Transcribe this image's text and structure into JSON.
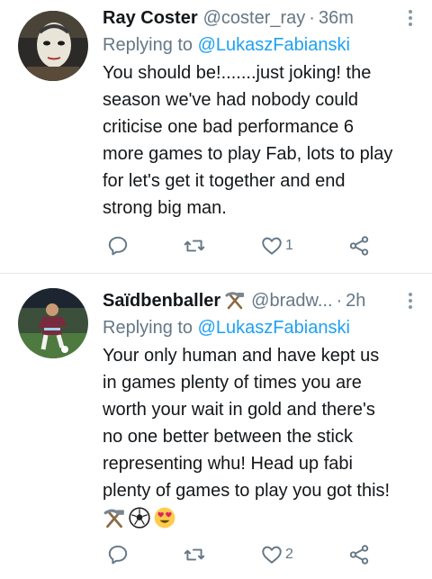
{
  "tweets": [
    {
      "name": "Ray Coster",
      "handle": "@coster_ray",
      "separator": "·",
      "time": "36m",
      "replying_prefix": "Replying to",
      "replying_to": "@LukaszFabianski",
      "text": "You should be!.......just joking! the\nseason we've had nobody could\ncriticise one bad performance 6\nmore games to play Fab, lots to play\nfor let's get it together and end\nstrong big man.",
      "like_count": "1"
    },
    {
      "name": "Saïdbenballer",
      "handle": "@bradw...",
      "separator": "·",
      "time": "2h",
      "replying_prefix": "Replying to",
      "replying_to": "@LukaszFabianski",
      "text": "Your only human and have kept us\nin games plenty of times you are\nworth your wait in gold and there's\nno one better between the stick\nrepresenting whu! Head up fabi\nplenty of games to play you got this!",
      "emojis": [
        "hammer-and-pick",
        "soccer-ball",
        "heart-eyes"
      ],
      "like_count": "2"
    }
  ],
  "colors": {
    "link": "#1da1f2",
    "muted": "#657786",
    "icon": "#657786",
    "divider": "#e1e8ed"
  }
}
